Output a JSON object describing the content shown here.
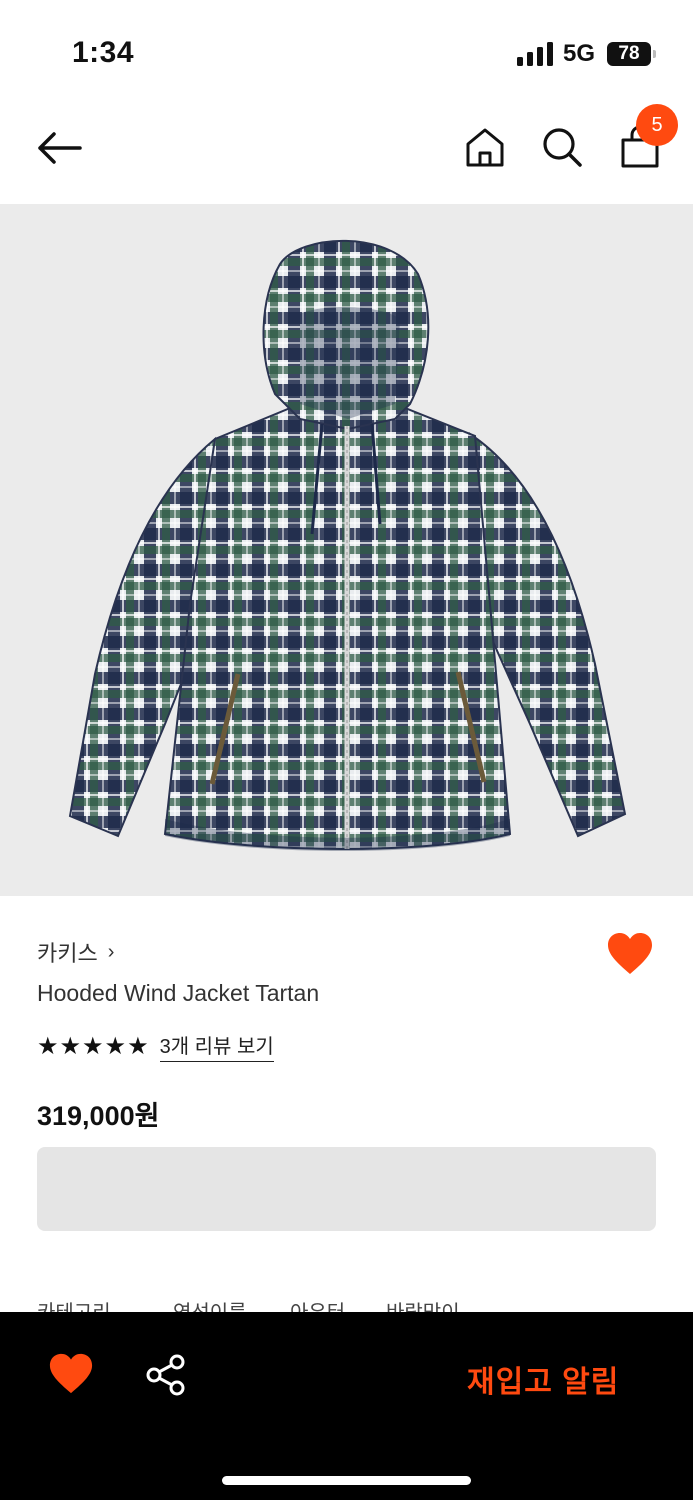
{
  "status": {
    "time": "1:34",
    "network": "5G",
    "battery": "78"
  },
  "header": {
    "cart_count": "5"
  },
  "product": {
    "brand": "카키스",
    "name": "Hooded Wind Jacket Tartan",
    "rating_stars": "★★★★★",
    "reviews_link": "3개 리뷰 보기",
    "price": "319,000원",
    "wishlisted": true
  },
  "tabs": [
    {
      "label": "카테고리"
    },
    {
      "label": "연선이름"
    },
    {
      "label": "아우터"
    },
    {
      "label": "바람막이"
    }
  ],
  "bottom_bar": {
    "restock_label": "재입고 알림"
  },
  "colors": {
    "accent": "#ff4a10",
    "image_bg": "#ebebeb",
    "bottom_bar": "#000000"
  },
  "icons": {
    "back": "arrow-left-icon",
    "home": "home-icon",
    "search": "search-icon",
    "cart": "shopping-bag-icon",
    "wishlist": "heart-icon",
    "share": "share-icon"
  }
}
